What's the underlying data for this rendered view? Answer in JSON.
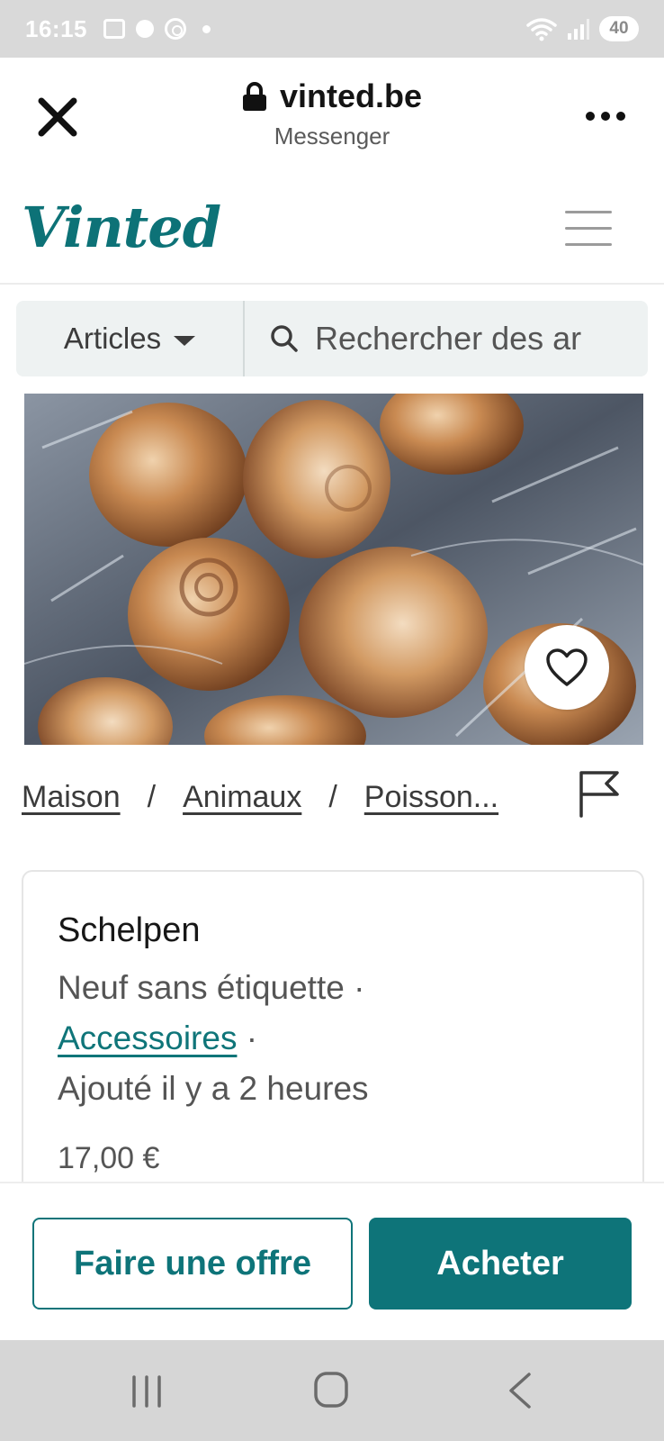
{
  "status_bar": {
    "time": "16:15",
    "battery": "40",
    "icons": [
      "screenshot-icon",
      "dot-icon",
      "signal-ring-icon",
      "small-dot-icon",
      "wifi-icon",
      "cell-signal-icon",
      "battery-icon"
    ]
  },
  "browser": {
    "domain": "vinted.be",
    "subtitle": "Messenger",
    "close_icon": "close-icon",
    "more_icon": "more-icon",
    "lock_icon": "lock-icon"
  },
  "vinted": {
    "logo": "Vinted",
    "brand_color": "#0e7479",
    "menu_icon": "hamburger-menu-icon"
  },
  "search": {
    "category_label": "Articles",
    "placeholder": "Rechercher des ar"
  },
  "photo": {
    "favorite_icon": "heart-icon"
  },
  "breadcrumb": {
    "items": [
      "Maison",
      "Animaux",
      "Poisson..."
    ],
    "separator": "/",
    "report_icon": "flag-icon"
  },
  "item": {
    "title": "Schelpen",
    "condition": "Neuf sans étiquette ·",
    "category_link": "Accessoires",
    "category_sep": " ·",
    "added": "Ajouté il y a 2 heures",
    "price": "17,00 €"
  },
  "actions": {
    "offer_label": "Faire une offre",
    "buy_label": "Acheter"
  },
  "nav": {
    "recent_icon": "recent-apps-icon",
    "home_icon": "home-icon",
    "back_icon": "back-icon"
  }
}
